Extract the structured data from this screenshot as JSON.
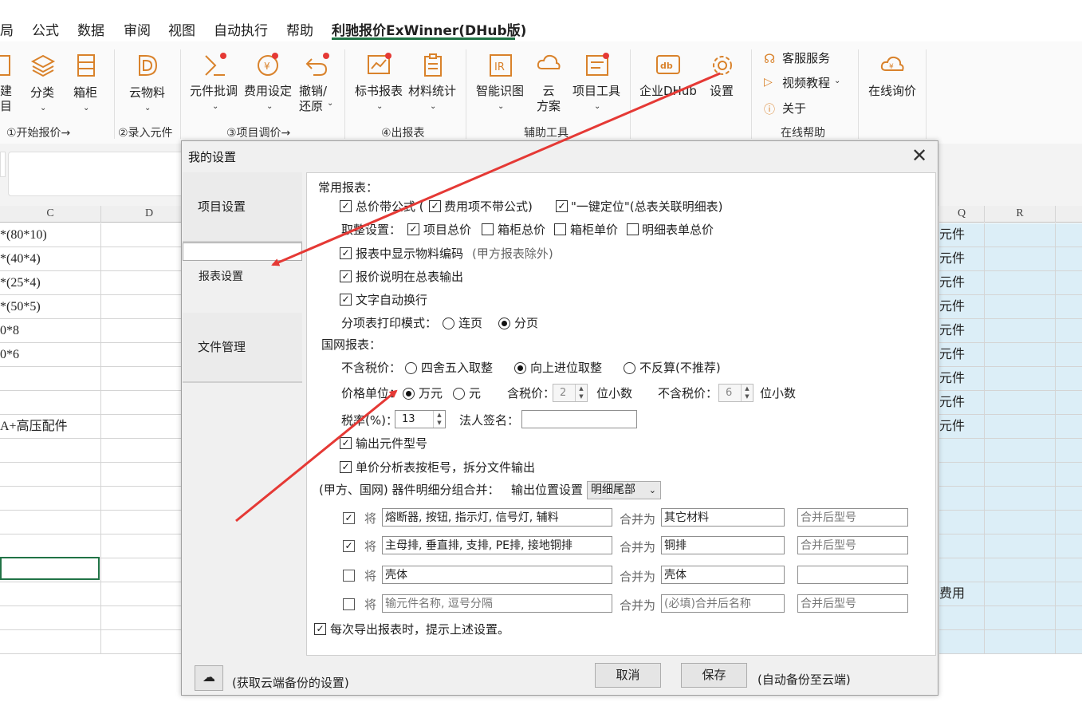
{
  "tabs": [
    {
      "label": "局"
    },
    {
      "label": "公式"
    },
    {
      "label": "数据"
    },
    {
      "label": "审阅"
    },
    {
      "label": "视图"
    },
    {
      "label": "自动执行"
    },
    {
      "label": "帮助"
    },
    {
      "label": "利驰报价ExWinner(DHub版)"
    }
  ],
  "ribbon": {
    "jian_label": "建\n目",
    "fenlei": "分类",
    "xianggui": "箱柜",
    "group1": "①开始报价→",
    "yunwuliao": "云物料",
    "group2": "②录入元件",
    "yuanjian_pitiao": "元件批调",
    "feiyong_sheding": "费用设定",
    "chexiao": "撤销/\n还原",
    "group3": "③项目调价→",
    "biaoshu_baobiao": "标书报表",
    "cailiao_tongji": "材料统计",
    "group4": "④出报表",
    "zhineng_shitu": "智能识图",
    "yun_fangan": "云\n方案",
    "xiangmu_gongju": "项目工具",
    "group5": "辅助工具",
    "qiye_dhub": "企业DHub",
    "shezhi": "设置",
    "kefu": "客服服务",
    "shipin": "视频教程",
    "guanyu": "关于",
    "group6": "在线帮助",
    "zaixian_xunjia": "在线询价"
  },
  "sheet": {
    "col_c": "C",
    "col_d": "D",
    "col_q": "Q",
    "col_r": "R",
    "c_cells": [
      "*(80*10)",
      "*(40*4)",
      "*(25*4)",
      "*(50*5)",
      "0*8",
      "0*6",
      "",
      "",
      "A+高压配件",
      "",
      "",
      "",
      "",
      "",
      "",
      "",
      "",
      ""
    ],
    "q_cells": [
      "元件",
      "元件",
      "元件",
      "元件",
      "元件",
      "元件",
      "元件",
      "元件",
      "元件",
      "",
      "",
      "",
      "",
      "",
      "",
      "费用",
      "",
      ""
    ]
  },
  "dialog": {
    "title": "我的设置",
    "nav": [
      "项目设置",
      "报表设置",
      "文件管理"
    ],
    "common_reports": "常用报表：",
    "total_price_formula": "总价带公式 (",
    "fee_no_formula": "费用项不带公式)",
    "one_key": "\"一键定位\"(总表关联明细表)",
    "round_setting": "取整设置：",
    "round_project_total": "项目总价",
    "round_cabinet_total": "箱柜总价",
    "round_cabinet_unit": "箱柜单价",
    "round_detail_total": "明细表单总价",
    "show_material_code": "报表中显示物料编码",
    "show_material_code_note": "(甲方报表除外)",
    "price_note_output": "报价说明在总表输出",
    "text_wrap": "文字自动换行",
    "print_mode_label": "分项表打印模式：",
    "print_continuous": "连页",
    "print_paged": "分页",
    "state_grid": "国网报表：",
    "ex_tax_label": "不含税价：",
    "round_half": "四舍五入取整",
    "round_up": "向上进位取整",
    "no_reverse": "不反算(不推荐)",
    "price_unit_label": "价格单位：",
    "unit_wan": "万元",
    "unit_yuan": "元",
    "incl_tax_label": "含税价：",
    "incl_tax_value": "2",
    "decimal_places": "位小数",
    "excl_tax_label": "不含税价：",
    "excl_tax_value": "6",
    "decimal_places2": "位小数",
    "tax_rate_label": "税率(%)：",
    "tax_rate_value": "13",
    "legal_sign_label": "法人签名：",
    "legal_sign_value": "",
    "output_model": "输出元件型号",
    "unit_analysis_split": "单价分析表按柜号，拆分文件输出",
    "merge_label": "(甲方、国网) 器件明细分组合并：",
    "output_position_label": "输出位置设置",
    "output_position_value": "明细尾部",
    "merge_rows": [
      {
        "jiang": "将",
        "items": "熔断器, 按钮, 指示灯, 信号灯, 辅料",
        "merge_as": "合并为",
        "target": "其它材料",
        "model": "合并后型号",
        "checked": "✓"
      },
      {
        "jiang": "将",
        "items": "主母排, 垂直排, 支排, PE排, 接地铜排",
        "merge_as": "合并为",
        "target": "铜排",
        "model": "合并后型号",
        "checked": "✓"
      },
      {
        "jiang": "将",
        "items": "壳体",
        "merge_as": "合并为",
        "target": "壳体",
        "model": "",
        "checked": ""
      },
      {
        "jiang": "将",
        "items": "输元件名称, 逗号分隔",
        "merge_as": "合并为",
        "target": "(必填)合并后名称",
        "model": "合并后型号",
        "checked": ""
      }
    ],
    "prompt_each_export": "每次导出报表时，提示上述设置。",
    "cloud_backup_note": "(获取云端备份的设置)",
    "cancel": "取消",
    "save": "保存",
    "auto_backup_note": "(自动备份至云端)"
  },
  "colors": {
    "accent": "#217346",
    "arrow": "#e53935",
    "sheet_blue": "#dceef7"
  }
}
